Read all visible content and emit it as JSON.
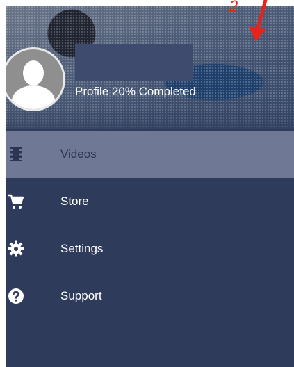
{
  "header": {
    "profile_status": "Profile 20% Completed"
  },
  "menu": {
    "items": [
      {
        "label": "Videos",
        "icon": "film-icon",
        "active": true
      },
      {
        "label": "Store",
        "icon": "cart-icon",
        "active": false
      },
      {
        "label": "Settings",
        "icon": "gear-icon",
        "active": false
      },
      {
        "label": "Support",
        "icon": "help-icon",
        "active": false
      }
    ]
  },
  "annotation": {
    "text": "2",
    "color": "#e5241b"
  },
  "colors": {
    "drawer_bg": "#2f3b5a",
    "active_item_bg": "#6f7895",
    "text": "#ffffff"
  }
}
